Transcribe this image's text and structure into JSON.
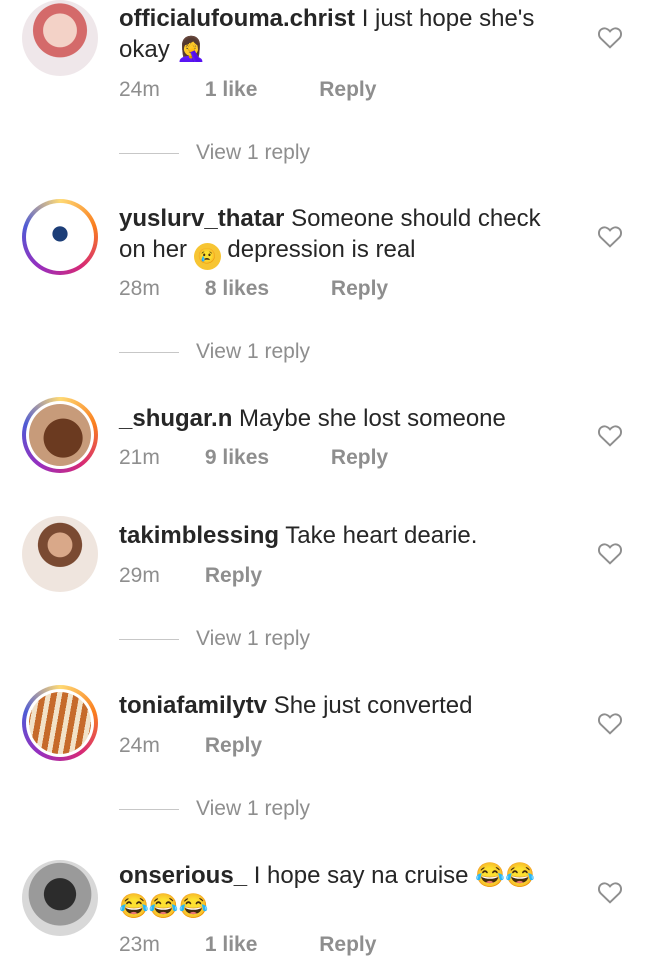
{
  "comments": [
    {
      "username": "officialufouma.christ",
      "text": "I just hope she's okay",
      "emoji": "🤦‍♀️",
      "time": "24m",
      "likes": "1 like",
      "reply": "Reply",
      "view_replies": "View 1 reply"
    },
    {
      "username": "yuslurv_thatar",
      "text": "Someone should check on her",
      "emoji": "😢",
      "text_after": "depression is real",
      "time": "28m",
      "likes": "8 likes",
      "reply": "Reply",
      "view_replies": "View 1 reply"
    },
    {
      "username": "_shugar.n",
      "text": "Maybe she lost someone",
      "time": "21m",
      "likes": "9 likes",
      "reply": "Reply"
    },
    {
      "username": "takimblessing",
      "text": "Take heart dearie.",
      "time": "29m",
      "reply": "Reply",
      "view_replies": "View 1 reply"
    },
    {
      "username": "toniafamilytv",
      "text": "She just converted",
      "time": "24m",
      "reply": "Reply",
      "view_replies": "View 1 reply"
    },
    {
      "username": "onserious_",
      "text": "I hope say na cruise",
      "emoji": "😂😂😂😂😂",
      "time": "23m",
      "likes": "1 like",
      "reply": "Reply"
    }
  ],
  "colors": {
    "text": "#262626",
    "meta": "#8e8e8e",
    "divider": "#c7c7c7",
    "ring_gradient": [
      "#feda75",
      "#fa7e1e",
      "#d62976",
      "#962fbf",
      "#4f5bd5"
    ]
  },
  "icons": {
    "like": "heart-outline-icon"
  }
}
